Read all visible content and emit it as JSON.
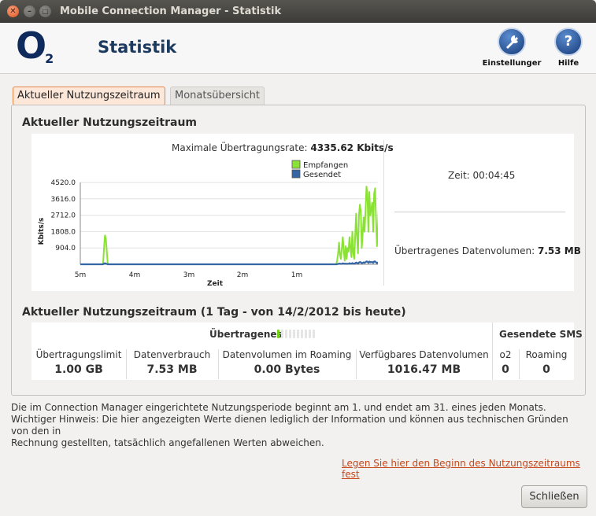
{
  "window": {
    "title": "Mobile Connection Manager - Statistik"
  },
  "header": {
    "logo_text": "O",
    "logo_sub": "2",
    "title": "Statistik",
    "settings_label": "Einstellunger",
    "help_label": "Hilfe"
  },
  "tabs": [
    {
      "label": "Aktueller Nutzungszeitraum",
      "selected": true
    },
    {
      "label": "Monatsübersicht",
      "selected": false
    }
  ],
  "current": {
    "heading": "Aktueller Nutzungszeitraum",
    "max_rate_label": "Maximale Übertragungsrate:",
    "max_rate_value": "4335.62 Kbits/s",
    "time_label": "Zeit:",
    "time_value": "00:04:45",
    "volume_label": "Übertragenes Datenvolumen:",
    "volume_value": "7.53 MB"
  },
  "chart_data": {
    "type": "line",
    "ylabel": "Kbits/s",
    "xlabel": "Zeit",
    "y_ticks": [
      "4520.0",
      "3616.0",
      "2712.0",
      "1808.0",
      "904.0"
    ],
    "x_ticks": [
      "5m",
      "4m",
      "3m",
      "2m",
      "1m"
    ],
    "ylim": [
      0,
      4520
    ],
    "legend_position": "top-right",
    "series": [
      {
        "name": "Empfangen",
        "color": "#8ae234",
        "values": [
          0,
          0,
          0,
          0,
          0,
          0,
          0,
          0,
          0,
          0,
          0,
          0,
          0,
          0,
          0,
          0,
          0,
          0,
          0,
          0,
          0,
          0,
          0,
          0,
          0,
          900,
          1600,
          1400,
          700,
          0,
          0,
          0,
          0,
          0,
          0,
          0,
          0,
          0,
          0,
          0,
          0,
          0,
          0,
          0,
          0,
          0,
          0,
          0,
          0,
          0,
          0,
          0,
          0,
          0,
          0,
          0,
          0,
          0,
          0,
          0,
          0,
          0,
          0,
          0,
          0,
          0,
          0,
          0,
          0,
          0,
          0,
          0,
          0,
          0,
          0,
          0,
          0,
          0,
          0,
          0,
          0,
          0,
          0,
          0,
          0,
          0,
          0,
          0,
          0,
          0,
          0,
          0,
          0,
          0,
          0,
          0,
          0,
          0,
          0,
          0,
          0,
          0,
          0,
          0,
          0,
          0,
          0,
          0,
          0,
          0,
          0,
          0,
          0,
          0,
          0,
          0,
          0,
          0,
          0,
          0,
          0,
          0,
          0,
          0,
          0,
          0,
          0,
          0,
          0,
          0,
          0,
          0,
          0,
          0,
          0,
          0,
          0,
          0,
          0,
          0,
          0,
          0,
          0,
          0,
          0,
          0,
          0,
          0,
          0,
          0,
          0,
          0,
          0,
          0,
          0,
          0,
          0,
          0,
          0,
          0,
          0,
          0,
          0,
          0,
          0,
          0,
          0,
          0,
          0,
          0,
          0,
          0,
          0,
          0,
          0,
          0,
          0,
          0,
          0,
          0,
          0,
          0,
          0,
          0,
          0,
          0,
          0,
          0,
          0,
          0,
          0,
          0,
          0,
          0,
          0,
          0,
          0,
          0,
          0,
          0,
          0,
          0,
          0,
          0,
          0,
          0,
          0,
          0,
          0,
          0,
          0,
          0,
          0,
          0,
          0,
          0,
          0,
          0,
          0,
          0,
          0,
          0,
          0,
          0,
          0,
          0,
          0,
          0,
          0,
          0,
          0,
          0,
          0,
          0,
          0,
          0,
          0,
          0,
          0,
          0,
          0,
          0,
          0,
          0,
          0,
          0,
          0,
          0,
          0,
          0,
          0,
          0,
          0,
          0,
          0,
          0,
          0,
          0,
          0,
          0,
          0,
          0,
          0,
          0,
          0,
          0,
          0,
          0,
          0,
          0,
          0,
          200,
          600,
          1200,
          500,
          300,
          900,
          1500,
          800,
          200,
          1000,
          300,
          900,
          700,
          1500,
          900,
          400,
          1800,
          600,
          300,
          1500,
          2800,
          1500,
          600,
          2700,
          3300,
          2900,
          900,
          1700,
          2600,
          1800,
          3000,
          4300,
          3800,
          1800,
          4000,
          2700,
          3100,
          3400,
          1800,
          3900,
          4200,
          2500,
          1000,
          2000,
          3300,
          4200,
          1600,
          3300,
          4200
        ]
      },
      {
        "name": "Gesendet",
        "color": "#3465a4",
        "values": [
          0,
          0,
          0,
          0,
          0,
          0,
          0,
          0,
          0,
          0,
          0,
          0,
          0,
          0,
          0,
          0,
          0,
          0,
          0,
          0,
          0,
          0,
          0,
          0,
          0,
          30,
          60,
          40,
          20,
          0,
          0,
          0,
          0,
          0,
          0,
          0,
          0,
          0,
          0,
          0,
          0,
          0,
          0,
          0,
          0,
          0,
          0,
          0,
          0,
          0,
          0,
          0,
          0,
          0,
          0,
          0,
          0,
          0,
          0,
          0,
          0,
          0,
          0,
          0,
          0,
          0,
          0,
          0,
          0,
          0,
          0,
          0,
          0,
          0,
          0,
          0,
          0,
          0,
          0,
          0,
          0,
          0,
          0,
          0,
          0,
          0,
          0,
          0,
          0,
          0,
          0,
          0,
          0,
          0,
          0,
          0,
          0,
          0,
          0,
          0,
          0,
          0,
          0,
          0,
          0,
          0,
          0,
          0,
          0,
          0,
          0,
          0,
          0,
          0,
          0,
          0,
          0,
          0,
          0,
          0,
          0,
          0,
          0,
          0,
          0,
          0,
          0,
          0,
          0,
          0,
          0,
          0,
          0,
          0,
          0,
          0,
          0,
          0,
          0,
          0,
          0,
          0,
          0,
          0,
          0,
          0,
          0,
          0,
          0,
          0,
          0,
          0,
          0,
          0,
          0,
          0,
          0,
          0,
          0,
          0,
          0,
          0,
          0,
          0,
          0,
          0,
          0,
          0,
          0,
          0,
          0,
          0,
          0,
          0,
          0,
          0,
          0,
          0,
          0,
          0,
          0,
          0,
          0,
          0,
          0,
          0,
          0,
          0,
          0,
          0,
          0,
          0,
          0,
          0,
          0,
          0,
          0,
          0,
          0,
          0,
          0,
          0,
          0,
          0,
          0,
          0,
          0,
          0,
          0,
          0,
          0,
          0,
          0,
          0,
          0,
          0,
          0,
          0,
          0,
          0,
          0,
          0,
          0,
          0,
          0,
          0,
          0,
          0,
          0,
          0,
          0,
          0,
          0,
          0,
          0,
          0,
          0,
          0,
          0,
          0,
          0,
          0,
          0,
          0,
          0,
          0,
          0,
          0,
          0,
          0,
          0,
          0,
          0,
          0,
          0,
          0,
          0,
          0,
          0,
          0,
          0,
          0,
          0,
          0,
          0,
          0,
          0,
          0,
          0,
          0,
          0,
          0,
          10,
          20,
          40,
          30,
          20,
          30,
          50,
          40,
          20,
          40,
          20,
          30,
          30,
          60,
          40,
          30,
          70,
          40,
          30,
          60,
          100,
          70,
          40,
          100,
          120,
          110,
          50,
          80,
          110,
          80,
          120,
          160,
          140,
          80,
          150,
          110,
          120,
          130,
          80,
          150,
          160,
          110,
          60,
          90,
          130,
          160,
          80,
          130,
          160
        ]
      }
    ]
  },
  "period": {
    "heading": "Aktueller Nutzungszeitraum (1 Tag - von 14/2/2012 bis heute)",
    "transferred_label": "Übertragenes",
    "transferred_progress": 0.05,
    "sms_label": "Gesendete SMS",
    "cells": [
      {
        "label": "Übertragungslimit",
        "value": "1.00 GB"
      },
      {
        "label": "Datenverbrauch",
        "value": "7.53 MB"
      },
      {
        "label": "Datenvolumen im Roaming",
        "value": "0.00 Bytes"
      },
      {
        "label": "Verfügbares Datenvolumen",
        "value": "1016.47 MB"
      }
    ],
    "sms_cells": [
      {
        "label": "o2",
        "value": "0"
      },
      {
        "label": "Roaming",
        "value": "0"
      }
    ]
  },
  "notes": {
    "line1": "Die im Connection Manager eingerichtete Nutzungsperiode beginnt am 1. und endet am 31. eines jeden Monats.",
    "line2": "Wichtiger Hinweis: Die hier angezeigten Werte dienen lediglich der Information und können aus technischen Gründen von den in",
    "line3": "Rechnung gestellten, tatsächlich angefallenen Werten abweichen."
  },
  "link_text": "Legen Sie hier den Beginn des Nutzungszeitraums fest",
  "close_label": "Schließen"
}
